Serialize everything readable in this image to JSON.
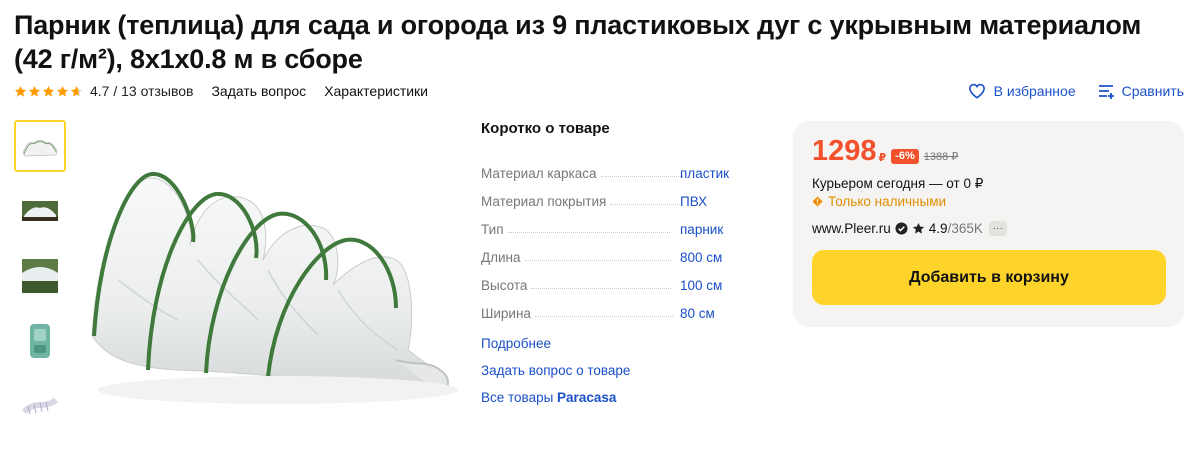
{
  "product": {
    "title": "Парник (теплица) для сада и огорода из 9 пластиковых дуг с укрывным материалом (42 г/м²), 8x1x0.8 м в сборе",
    "rating_value": 4.7,
    "rating_text": "4.7 / 13 отзывов"
  },
  "header_links": {
    "ask_question": "Задать вопрос",
    "characteristics": "Характеристики"
  },
  "actions": {
    "favorite": "В избранное",
    "compare": "Сравнить"
  },
  "gallery": {
    "thumb_count": 5,
    "active_index": 0
  },
  "about": {
    "title": "Коротко о товаре",
    "specs": [
      {
        "name": "Материал каркаса",
        "value": "пластик"
      },
      {
        "name": "Материал покрытия",
        "value": "ПВХ"
      },
      {
        "name": "Тип",
        "value": "парник"
      },
      {
        "name": "Длина",
        "value": "800 см"
      },
      {
        "name": "Высота",
        "value": "100 см"
      },
      {
        "name": "Ширина",
        "value": "80 см"
      }
    ],
    "more_link": "Подробнее",
    "ask_link": "Задать вопрос о товаре",
    "all_goods_prefix": "Все товары ",
    "brand": "Paracasa"
  },
  "offer": {
    "price": "1298",
    "currency": "₽",
    "discount": "-6%",
    "old_price": "1388 ₽",
    "delivery": "Курьером сегодня — от 0 ₽",
    "payment_note": "Только наличными",
    "shop_name": "www.Pleer.ru",
    "shop_rating": "4.9",
    "shop_reviews": "/365K",
    "more": "···",
    "add_to_cart": "Добавить в корзину"
  },
  "colors": {
    "accent_yellow": "#fed42b",
    "price_red": "#f2512b",
    "link_blue": "#1a50c8",
    "warning_orange": "#e08d00",
    "star_orange": "#ff9a00"
  }
}
